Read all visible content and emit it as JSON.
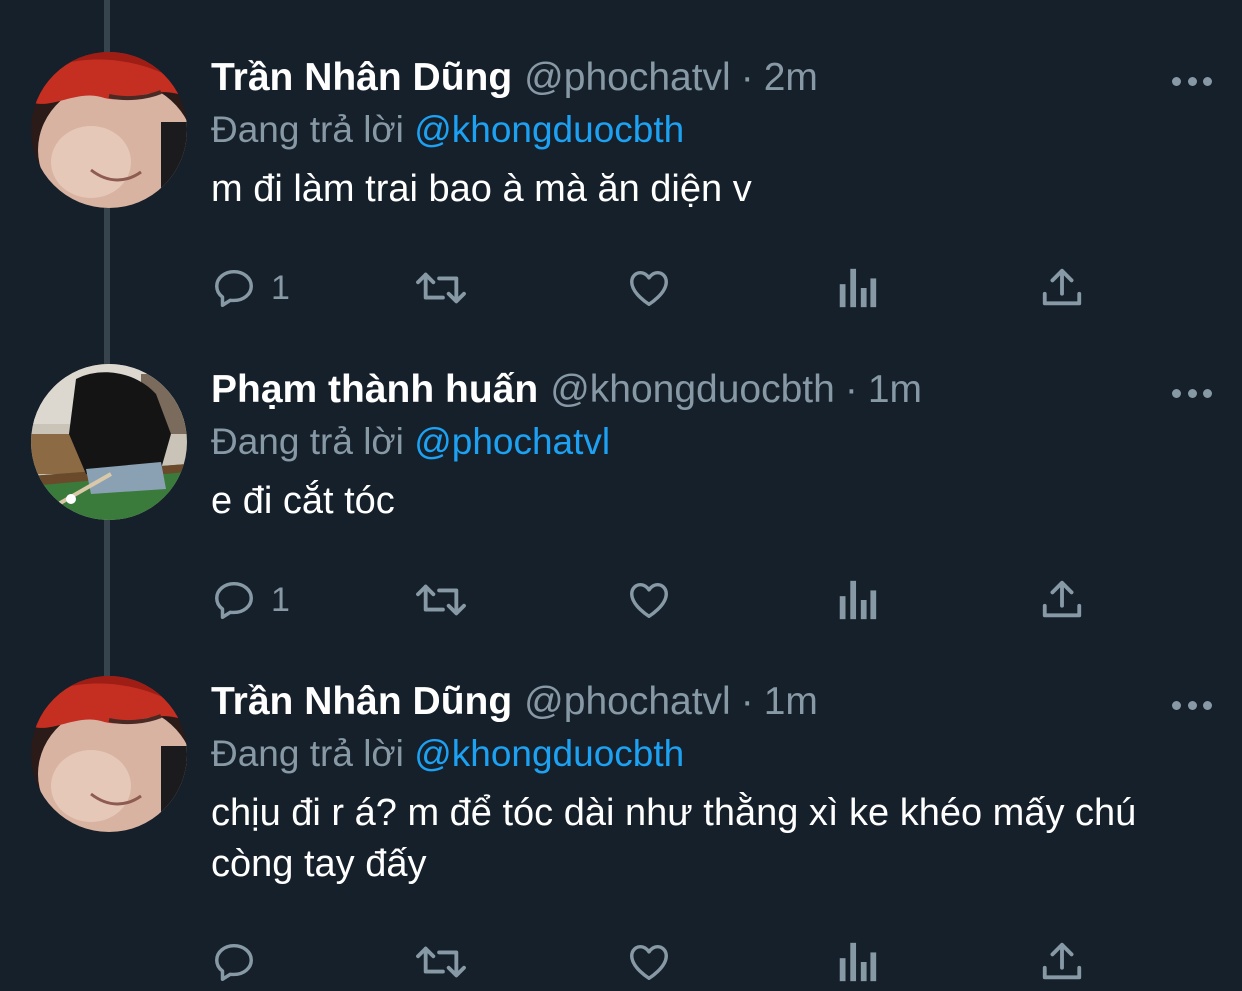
{
  "tweets": [
    {
      "display_name": "Trần Nhân Dũng",
      "handle": "@phochatvl",
      "separator": "·",
      "time": "2m",
      "replying_prefix": "Đang trả lời",
      "replying_to": "@khongduocbth",
      "text": "m đi làm trai bao à mà ăn diện v",
      "reply_count": "1",
      "avatar_icon": "avatar-red-hair-photo"
    },
    {
      "display_name": "Phạm thành huấn",
      "handle": "@khongduocbth",
      "separator": "·",
      "time": "1m",
      "replying_prefix": "Đang trả lời",
      "replying_to": "@phochatvl",
      "text": "e đi cắt tóc",
      "reply_count": "1",
      "avatar_icon": "avatar-billiards-photo"
    },
    {
      "display_name": "Trần Nhân Dũng",
      "handle": "@phochatvl",
      "separator": "·",
      "time": "1m",
      "replying_prefix": "Đang trả lời",
      "replying_to": "@khongduocbth",
      "text": "chịu đi r á? m để tóc dài như thằng xì ke khéo mấy chú còng tay đấy",
      "reply_count": "",
      "avatar_icon": "avatar-red-hair-photo"
    }
  ],
  "icons": {
    "reply": "reply-icon",
    "retweet": "retweet-icon",
    "like": "heart-icon",
    "analytics": "analytics-icon",
    "share": "share-icon",
    "more": "more-icon"
  },
  "colors": {
    "background": "#15202b",
    "primary_text": "#ffffff",
    "secondary_text": "#8899a6",
    "accent": "#1da1f2",
    "thread_line": "#38444d"
  }
}
